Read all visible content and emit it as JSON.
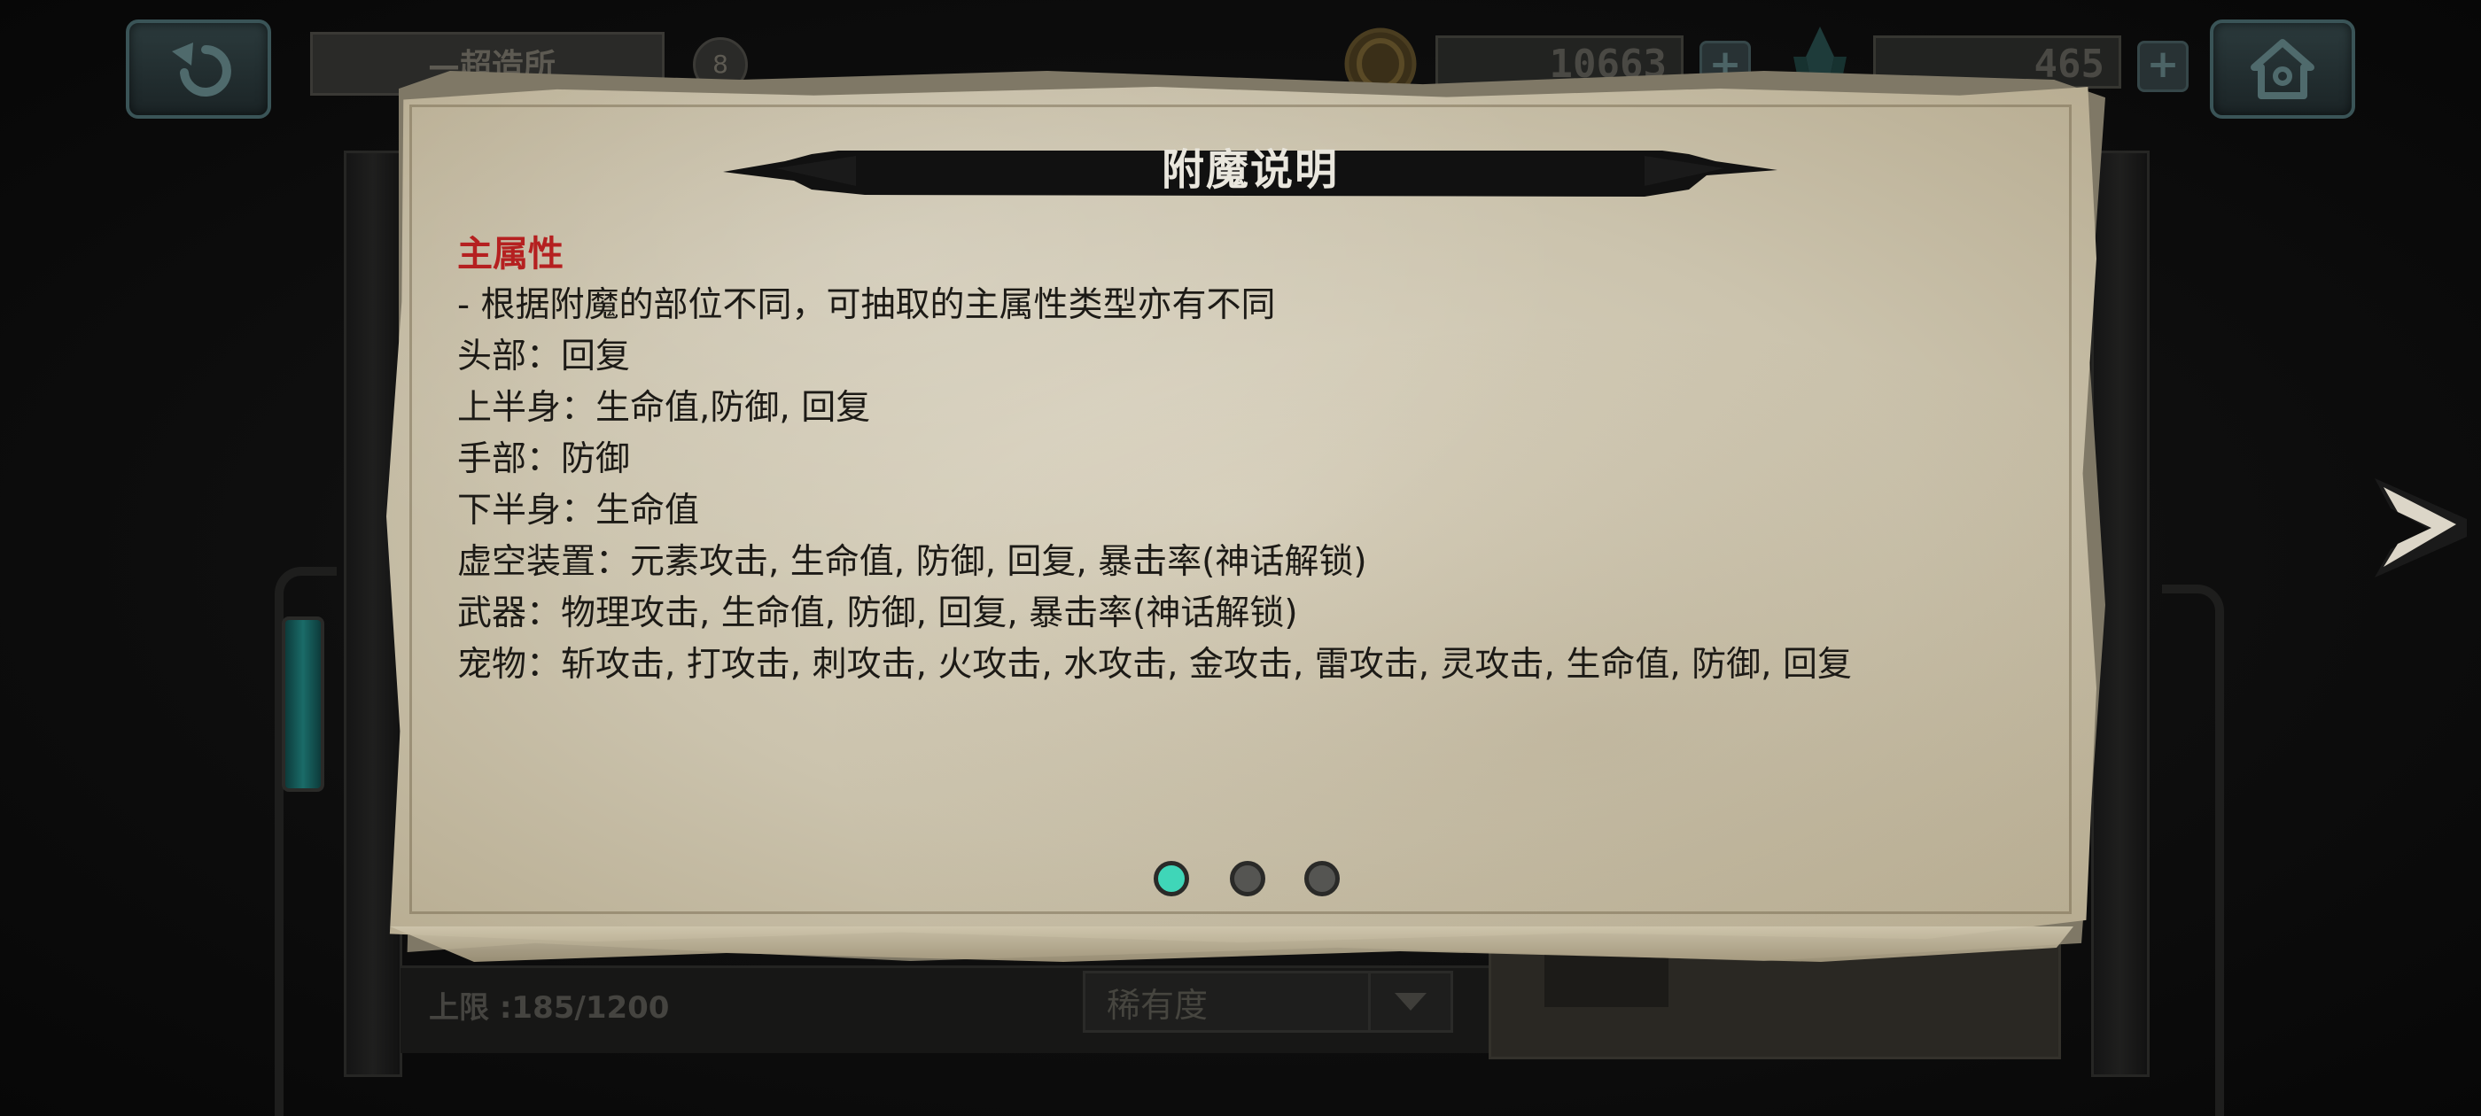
{
  "topbar": {
    "title_fragment": "—超造所",
    "badge": "8",
    "gold_amount": "10663",
    "gem_amount": "465",
    "plus_label": "+"
  },
  "bottom": {
    "capacity": "上限 :185/1200",
    "rarity_label": "稀有度"
  },
  "dialog": {
    "title": "附魔说明",
    "section_heading": "主属性",
    "lines": [
      "- 根据附魔的部位不同，可抽取的主属性类型亦有不同",
      "头部：回复",
      "上半身：生命值,防御, 回复",
      "手部：防御",
      "下半身：生命值",
      "虚空装置：元素攻击, 生命值, 防御, 回复, 暴击率(神话解锁)",
      "武器：物理攻击, 生命值, 防御, 回复, 暴击率(神话解锁)",
      "宠物：斩攻击, 打攻击, 刺攻击, 火攻击, 水攻击, 金攻击, 雷攻击, 灵攻击, 生命值, 防御, 回复"
    ]
  },
  "pagination": {
    "total": 3,
    "current": 1
  },
  "icons": {
    "back": "back-arrow-icon",
    "home": "home-icon",
    "coin": "coin-icon",
    "crystal": "crystal-icon",
    "next": "next-arrow-icon",
    "dropdown": "chevron-down-icon"
  },
  "colors": {
    "heading_red": "#b52020",
    "dot_active": "#3fd6b8",
    "dot_inactive": "#555552",
    "banner_black": "#111111",
    "paper": "#d4ccb6"
  }
}
